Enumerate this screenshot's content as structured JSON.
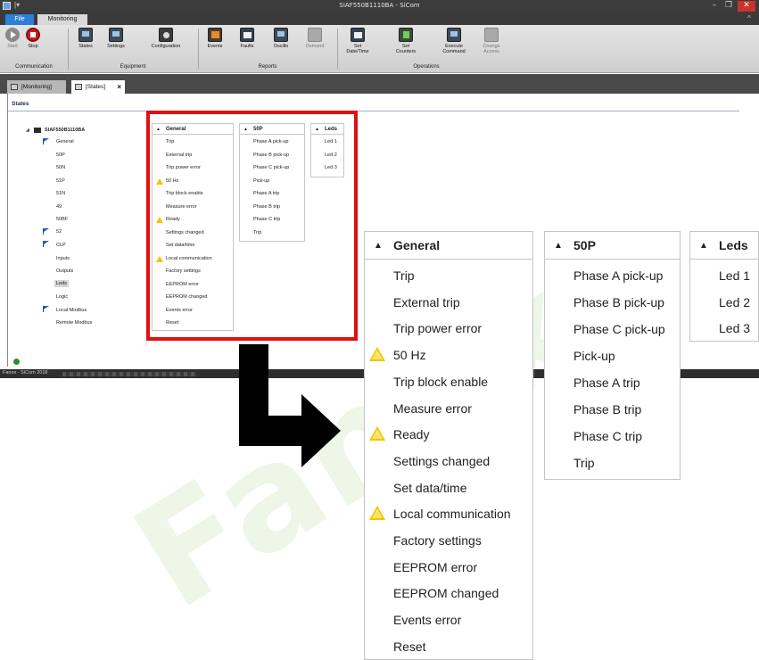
{
  "window": {
    "title": "SIAF550B1110BA - SiCom",
    "min": "–",
    "max": "❐",
    "close": "✕"
  },
  "ribbon": {
    "tabs": [
      "File",
      "Monitoring"
    ],
    "collapse": "^",
    "buttons": [
      {
        "label": "Start",
        "icon": "start-icon",
        "disabled": true
      },
      {
        "label": "Stop",
        "icon": "stop-icon"
      },
      {
        "label": "States",
        "icon": "states-icon"
      },
      {
        "label": "Settings",
        "icon": "settings-icon"
      },
      {
        "label": "Configuration",
        "icon": "configuration-icon"
      },
      {
        "label": "Events",
        "icon": "events-icon"
      },
      {
        "label": "Faults",
        "icon": "faults-icon"
      },
      {
        "label": "Oscillo",
        "icon": "oscillo-icon"
      },
      {
        "label": "Demand",
        "icon": "demand-icon",
        "disabled": true
      },
      {
        "label": "Set\nDate/Time",
        "icon": "set-datetime-icon"
      },
      {
        "label": "Set\nCounters",
        "icon": "set-counters-icon"
      },
      {
        "label": "Execute\nCommand",
        "icon": "execute-command-icon"
      },
      {
        "label": "Change\nAccess",
        "icon": "change-access-icon",
        "disabled": true
      }
    ],
    "groups": [
      "Communication",
      "Equipment",
      "Reports",
      "Operations"
    ]
  },
  "doc_tabs": [
    {
      "label": "[Monitoring]"
    },
    {
      "label": "[States]",
      "close": "×"
    }
  ],
  "states_header": "States",
  "tree": {
    "root": "SIAF550B1110BA",
    "items": [
      "General",
      "50P",
      "50N",
      "51P",
      "51N",
      "49",
      "50BF",
      "52",
      "CLP",
      "Inputs",
      "Outputs",
      "Leds",
      "Logic",
      "Local Modbus",
      "Remote Modbus"
    ],
    "selected": "Leds"
  },
  "status_bar": "Fanox - SiCom 2018",
  "panels": {
    "general": {
      "title": "General",
      "items": [
        {
          "label": "Trip",
          "warning": false
        },
        {
          "label": "External trip",
          "warning": false
        },
        {
          "label": "Trip power error",
          "warning": false
        },
        {
          "label": "50 Hz",
          "warning": true
        },
        {
          "label": "Trip block enable",
          "warning": false
        },
        {
          "label": "Measure error",
          "warning": false
        },
        {
          "label": "Ready",
          "warning": true
        },
        {
          "label": "Settings changed",
          "warning": false
        },
        {
          "label": "Set data/time",
          "warning": false
        },
        {
          "label": "Local communication",
          "warning": true
        },
        {
          "label": "Factory settings",
          "warning": false
        },
        {
          "label": "EEPROM error",
          "warning": false
        },
        {
          "label": "EEPROM changed",
          "warning": false
        },
        {
          "label": "Events error",
          "warning": false
        },
        {
          "label": "Reset",
          "warning": false
        }
      ]
    },
    "p50": {
      "title": "50P",
      "items": [
        "Phase A pick-up",
        "Phase B pick-up",
        "Phase C pick-up",
        "Pick-up",
        "Phase A trip",
        "Phase B trip",
        "Phase C trip",
        "Trip"
      ]
    },
    "leds": {
      "title": "Leds",
      "items": [
        "Led 1",
        "Led 2",
        "Led 3"
      ]
    }
  },
  "colors": {
    "highlight": "#e01010",
    "warning": "#f1c500",
    "file_tab": "#2d7fd8",
    "watermark": "#8cc864"
  },
  "watermark": "Fanox"
}
